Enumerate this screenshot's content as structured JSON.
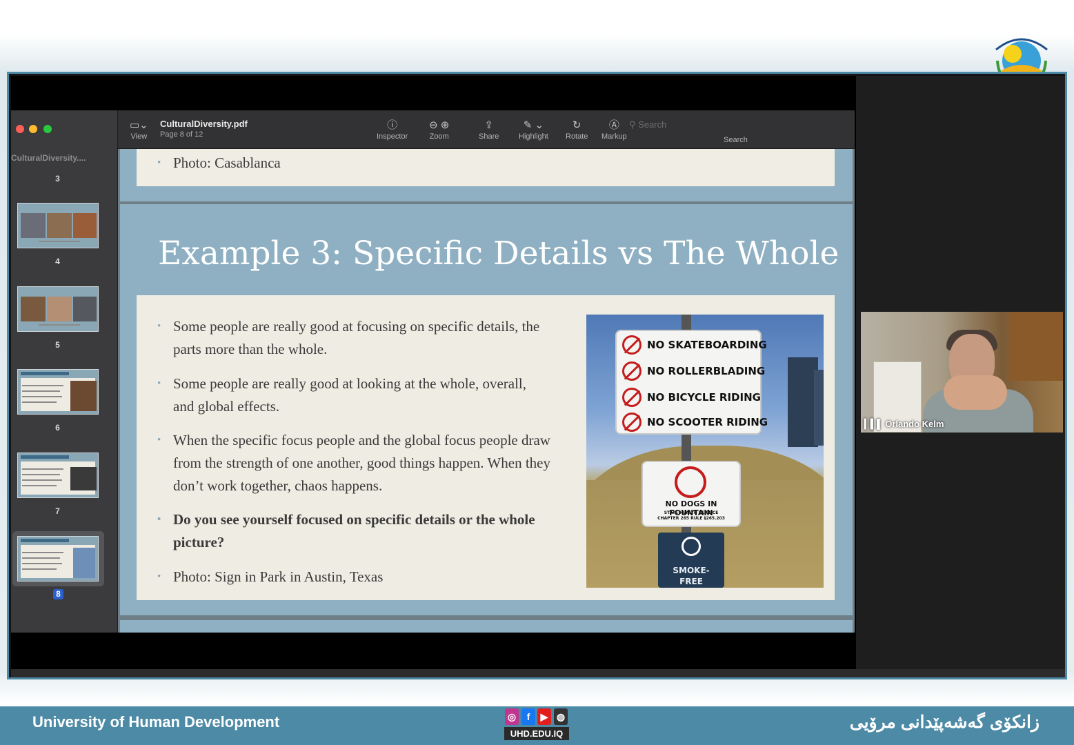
{
  "window": {
    "doc_title": "CulturalDiversity.pdf",
    "page_indicator": "Page 8 of 12",
    "sidebar_title": "CulturalDiversity....",
    "toolbar": {
      "view": "View",
      "inspector": "Inspector",
      "zoom": "Zoom",
      "share": "Share",
      "highlight": "Highlight",
      "rotate": "Rotate",
      "markup": "Markup",
      "search_placeholder": "Search",
      "search_label": "Search"
    }
  },
  "sidebar": {
    "page_numbers": [
      "3",
      "4",
      "5",
      "6",
      "7",
      "8"
    ],
    "thumbnails": [
      {
        "label": "Thumb page 4"
      },
      {
        "label": "Thumb page 5"
      },
      {
        "label": "Thumb page 6"
      },
      {
        "label": "Thumb page 7"
      },
      {
        "label": "Thumb page 8"
      }
    ],
    "selected_page": "8"
  },
  "slides": {
    "previous_bullet": "Photo: Casablanca",
    "current": {
      "title": "Example 3: Specific Details vs The Whole",
      "bullets": [
        "Some people are really good at focusing on specific details, the parts more than the whole.",
        "Some people are really good at looking at the whole, overall, and global effects.",
        "When the specific focus people and the global focus people draw from the strength of one another, good things happen. When they don’t work together, chaos happens.",
        "Do you see yourself focused on specific details or the whole picture?",
        "Photo: Sign in Park in Austin, Texas"
      ]
    },
    "photo_signs": {
      "rows": [
        "NO SKATEBOARDING",
        "NO ROLLERBLADING",
        "NO BICYCLE RIDING",
        "NO SCOOTER RIDING"
      ],
      "dog_line1": "NO DOGS IN FOUNTAIN",
      "dog_line2": "STATE HEALTH SERVICE",
      "dog_line3": "CHAPTER 265 RULE §265.203",
      "smoke_line1": "SMOKE-",
      "smoke_line2": "FREE"
    }
  },
  "participant": {
    "name": "Orlando Kelm"
  },
  "footer": {
    "university_en": "University of Human Development",
    "university_ku": "زانكۆی گەشەپێدانی مرۆیی",
    "website": "UHD.EDU.IQ",
    "social_icons": [
      "instagram-icon",
      "facebook-icon",
      "youtube-icon",
      "web-icon"
    ]
  },
  "colors": {
    "frame_border": "#4c8aa6",
    "slide_blue": "#8fb0c2",
    "paper": "#efece3",
    "footer": "#4c8aa6"
  }
}
